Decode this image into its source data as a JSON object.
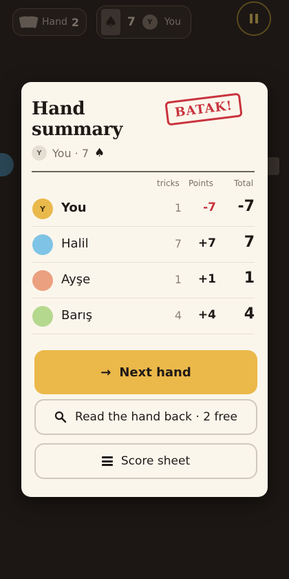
{
  "topbar": {
    "hand_label": "Hand",
    "hand_count": "2",
    "trump_suit": "♠",
    "bid_value": "7",
    "bidder_initial": "Y",
    "bidder_name": "You"
  },
  "summary": {
    "title": "Hand summary",
    "stamp": "BATAK!",
    "bid": {
      "initial": "Y",
      "text": "You · 7",
      "suit": "♠"
    },
    "columns": {
      "tricks": "tricks",
      "points": "Points",
      "total": "Total"
    },
    "rows": [
      {
        "initial": "Y",
        "name": "You",
        "tricks": "1",
        "points": "-7",
        "total": "-7",
        "color": "#e9b94c",
        "points_color": "#c9333d"
      },
      {
        "initial": "",
        "name": "Halil",
        "tricks": "7",
        "points": "+7",
        "total": "7",
        "color": "#7fc4e6",
        "points_color": "#1f1a16"
      },
      {
        "initial": "",
        "name": "Ayşe",
        "tricks": "1",
        "points": "+1",
        "total": "1",
        "color": "#eba07f",
        "points_color": "#1f1a16"
      },
      {
        "initial": "",
        "name": "Barış",
        "tricks": "4",
        "points": "+4",
        "total": "4",
        "color": "#b5d88f",
        "points_color": "#1f1a16"
      }
    ]
  },
  "actions": {
    "next_arrow": "→",
    "next_label": "Next hand",
    "read_icon": "magnifier-icon",
    "read_label": "Read the hand back · 2 free",
    "sheet_icon": "menu-icon",
    "sheet_label": "Score sheet"
  },
  "colors": {
    "accent": "#ebb84a",
    "stamp": "#c9333d",
    "negative": "#c9333d"
  }
}
